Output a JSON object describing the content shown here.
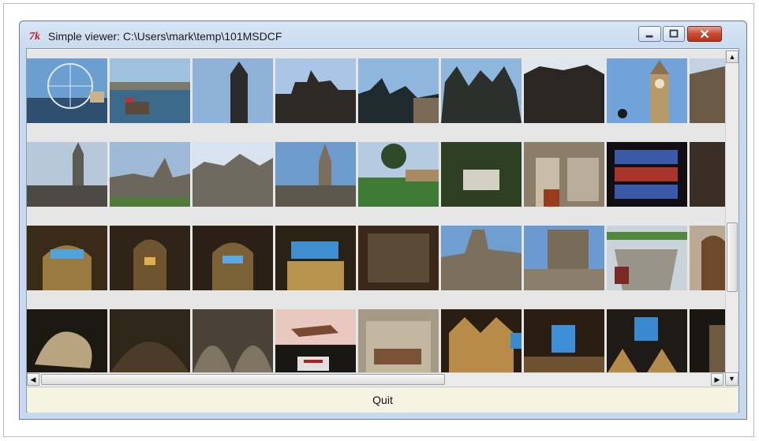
{
  "window": {
    "title": "Simple viewer: C:\\Users\\mark\\temp\\101MSDCF"
  },
  "controls": {
    "minimize_icon": "minimize-icon",
    "maximize_icon": "maximize-icon",
    "close_icon": "close-icon"
  },
  "quit_button": {
    "label": "Quit"
  },
  "scrollbars": {
    "up_arrow": "▲",
    "down_arrow": "▼",
    "left_arrow": "◀",
    "right_arrow": "▶"
  }
}
